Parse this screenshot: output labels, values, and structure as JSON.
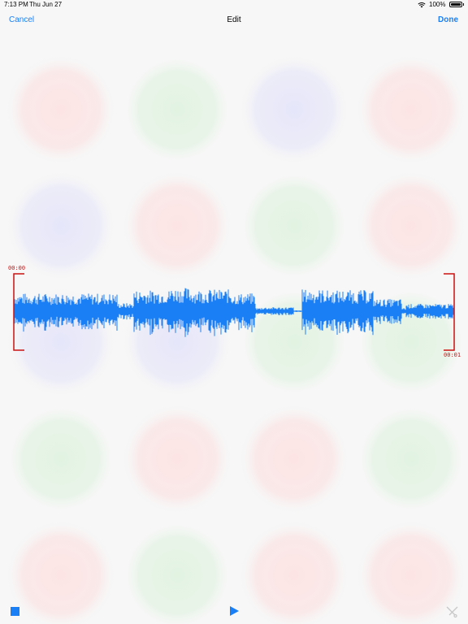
{
  "status": {
    "time": "7:13 PM",
    "date": "Thu Jun 27",
    "battery": "100%"
  },
  "nav": {
    "cancel": "Cancel",
    "title": "Edit",
    "done": "Done"
  },
  "waveform": {
    "start_time": "00:00",
    "end_time": "00:01"
  },
  "colors": {
    "accent": "#1a7ff5",
    "trim_handle": "#cc1111",
    "wave": "#1a7ff5"
  },
  "icons": {
    "wifi": "wifi-icon",
    "battery": "battery-icon",
    "stop": "stop-icon",
    "play": "play-icon",
    "trim": "trim-icon"
  }
}
